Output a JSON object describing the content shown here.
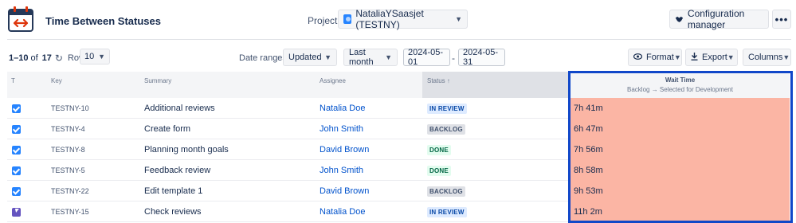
{
  "app": {
    "title": "Time Between Statuses",
    "project_label": "Project:",
    "project_value": "NataliaYSaasjet (TESTNY)",
    "config_label": "Configuration manager",
    "more_label": "•••"
  },
  "toolbar": {
    "range_label": "1–10",
    "of_label": "of",
    "total": "17",
    "rows_label": "Rows:",
    "rows_value": "10",
    "date_ranges_label": "Date ranges:",
    "date_field": "Updated",
    "period": "Last month",
    "date_from": "2024-05-01",
    "date_separator": "-",
    "date_to": "2024-05-31",
    "format_label": "Format",
    "export_label": "Export",
    "columns_label": "Columns"
  },
  "table": {
    "headers": {
      "type": "T",
      "key": "Key",
      "summary": "Summary",
      "assignee": "Assignee",
      "status": "Status ↑",
      "wait_title": "Wait Time",
      "wait_subtitle": "Backlog → Selected for Development"
    },
    "rows": [
      {
        "type": "task",
        "key": "TESTNY-10",
        "summary": "Additional reviews",
        "assignee": "Natalia Doe",
        "status": "IN REVIEW",
        "wait": "7h 41m"
      },
      {
        "type": "task",
        "key": "TESTNY-4",
        "summary": "Create form",
        "assignee": "John Smith",
        "status": "BACKLOG",
        "wait": "6h 47m"
      },
      {
        "type": "task",
        "key": "TESTNY-8",
        "summary": "Planning month goals",
        "assignee": "David Brown",
        "status": "DONE",
        "wait": "7h 56m"
      },
      {
        "type": "task",
        "key": "TESTNY-5",
        "summary": "Feedback review",
        "assignee": "John Smith",
        "status": "DONE",
        "wait": "8h 58m"
      },
      {
        "type": "task",
        "key": "TESTNY-22",
        "summary": "Edit template 1",
        "assignee": "David Brown",
        "status": "BACKLOG",
        "wait": "9h 53m"
      },
      {
        "type": "epic",
        "key": "TESTNY-15",
        "summary": "Check reviews",
        "assignee": "Natalia Doe",
        "status": "IN REVIEW",
        "wait": "11h 2m"
      }
    ]
  },
  "colors": {
    "wait_cell": "#fbb5a4",
    "highlight_border": "#1047c9",
    "link": "#0052cc"
  }
}
